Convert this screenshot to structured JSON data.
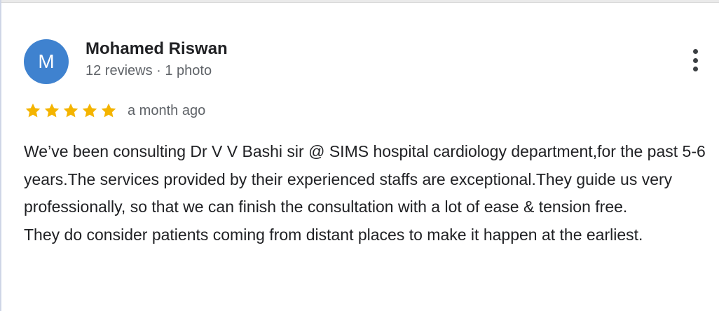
{
  "reviewer": {
    "initial": "M",
    "name": "Mohamed Riswan",
    "meta": "12 reviews · 1 photo",
    "avatar_color": "#3f82cf"
  },
  "review": {
    "rating": 5,
    "max_rating": 5,
    "star_color": "#f4b400",
    "date": "a month ago",
    "paragraphs": [
      "We’ve been consulting Dr V V Bashi sir @ SIMS hospital cardiology department,for the past 5-6 years.The services provided by their experienced staffs are exceptional.They guide us very professionally, so that we can finish the consultation with a lot of ease & tension free.",
      "They do consider patients coming from distant places to make it happen at the earliest."
    ]
  },
  "actions": {
    "more_icon": "more-vertical-icon"
  }
}
